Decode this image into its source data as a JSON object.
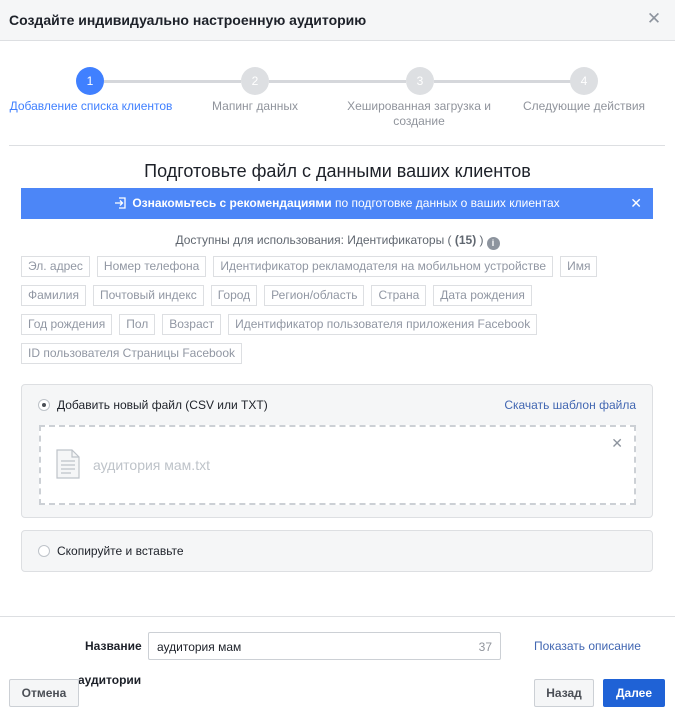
{
  "dialog": {
    "title": "Создайте индивидуально настроенную аудиторию",
    "close_icon": "close-icon"
  },
  "stepper": {
    "active_index": 0,
    "steps": [
      {
        "number": "1",
        "label": "Добавление списка клиентов"
      },
      {
        "number": "2",
        "label": "Мапинг данных"
      },
      {
        "number": "3",
        "label_line1": "Хешированная загрузка и",
        "label_line2": "создание"
      },
      {
        "number": "4",
        "label": "Следующие действия"
      }
    ]
  },
  "section": {
    "title": "Подготовьте файл с данными ваших клиентов"
  },
  "banner": {
    "icon": "external-link-icon",
    "bold_text": "Ознакомьтесь с рекомендациями",
    "rest_text": " по подготовке данных о ваших клиентах",
    "background": "#4c86f7"
  },
  "identifiers": {
    "prefix": "Доступны для использования: Идентификаторы ( ",
    "count": "(15)",
    "suffix": " )",
    "info_icon": "info-icon",
    "rows": [
      [
        "Эл. адрес",
        "Номер телефона",
        "Идентификатор рекламодателя на мобильном устройстве",
        "Имя"
      ],
      [
        "Фамилия",
        "Почтовый индекс",
        "Город",
        "Регион/область",
        "Страна",
        "Дата рождения"
      ],
      [
        "Год рождения",
        "Пол",
        "Возраст",
        "Идентификатор пользователя приложения Facebook"
      ],
      [
        "ID пользователя Страницы Facebook"
      ]
    ]
  },
  "upload": {
    "option_label": "Добавить новый файл (CSV или TXT)",
    "selected": true,
    "template_link": "Скачать шаблон файла",
    "file_name": "аудитория мам.txt",
    "remove_icon": "close-icon"
  },
  "paste": {
    "option_label": "Скопируйте и вставьте",
    "selected": false
  },
  "footer": {
    "name_label_line1": "Название",
    "name_label_line2": "аудитории",
    "name_value": "аудитория мам",
    "name_char_count": "37",
    "show_description": "Показать описание",
    "cancel": "Отмена",
    "back": "Назад",
    "next": "Далее",
    "accent": "#1f62d6"
  }
}
